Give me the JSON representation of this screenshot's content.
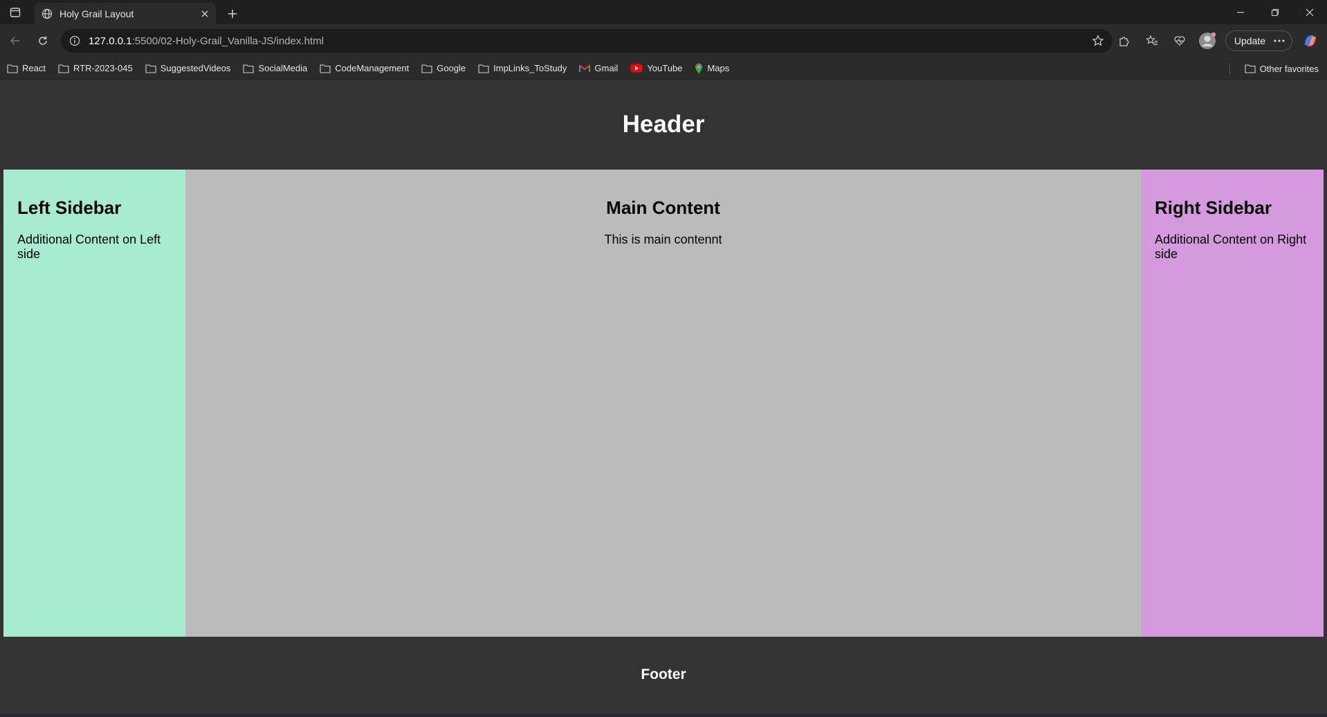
{
  "browser": {
    "tab": {
      "title": "Holy Grail Layout"
    },
    "address": {
      "host": "127.0.0.1",
      "path": ":5500/02-Holy-Grail_Vanilla-JS/index.html"
    },
    "update_label": "Update",
    "bookmarks": [
      {
        "label": "React",
        "icon": "folder-icon"
      },
      {
        "label": "RTR-2023-045",
        "icon": "folder-icon"
      },
      {
        "label": "SuggestedVideos",
        "icon": "folder-icon"
      },
      {
        "label": "SocialMedia",
        "icon": "folder-icon"
      },
      {
        "label": "CodeManagement",
        "icon": "folder-icon"
      },
      {
        "label": "Google",
        "icon": "folder-icon"
      },
      {
        "label": "ImpLinks_ToStudy",
        "icon": "folder-icon"
      },
      {
        "label": "Gmail",
        "icon": "gmail-icon"
      },
      {
        "label": "YouTube",
        "icon": "youtube-icon"
      },
      {
        "label": "Maps",
        "icon": "maps-icon"
      }
    ],
    "other_favorites": "Other favorites"
  },
  "page": {
    "header": "Header",
    "left": {
      "title": "Left Sidebar",
      "text": "Additional Content on Left side",
      "color": "#a6ecd1"
    },
    "main": {
      "title": "Main Content",
      "text": "This is main contennt",
      "color": "#bbbbbb"
    },
    "right": {
      "title": "Right Sidebar",
      "text": "Additional Content on Right side",
      "color": "#d49add"
    },
    "footer": "Footer"
  }
}
